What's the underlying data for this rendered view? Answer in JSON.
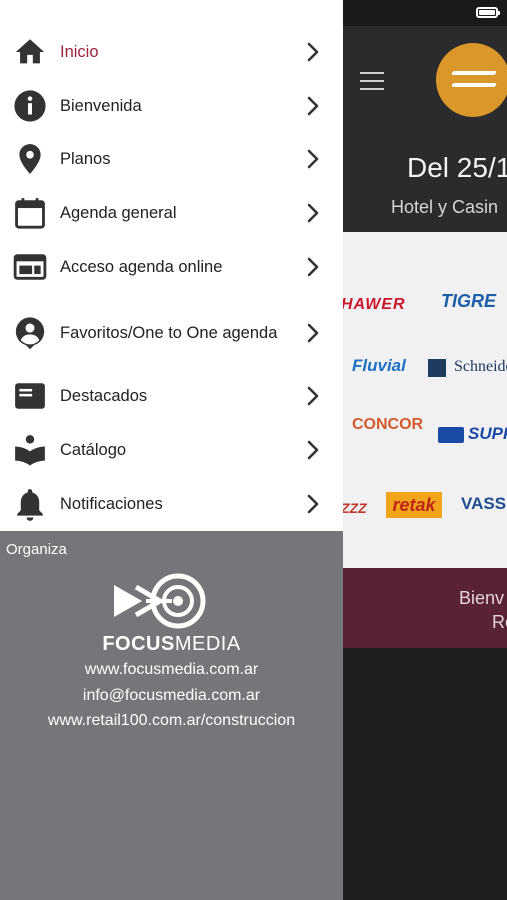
{
  "status_bar": {
    "battery_icon": "battery-full-icon"
  },
  "app": {
    "menu_icon": "hamburger-menu-icon",
    "brand_color": "#d99829",
    "date_title": "Del 25/1",
    "venue": "Hotel y Casin",
    "sponsors": [
      "HAWER",
      "TIGRE",
      "Fluvial",
      "Schneide",
      "CONCOR",
      "SUPP",
      "ZZZ",
      "retak",
      "VASSE"
    ],
    "welcome_line1": "Bienv",
    "welcome_line2": "Re"
  },
  "drawer": {
    "accent_color": "#9b2440",
    "items": [
      {
        "label": "Inicio",
        "icon": "home-icon",
        "active": true
      },
      {
        "label": "Bienvenida",
        "icon": "info-icon"
      },
      {
        "label": "Planos",
        "icon": "map-pin-icon"
      },
      {
        "label": "Agenda general",
        "icon": "calendar-icon"
      },
      {
        "label": "Acceso agenda online",
        "icon": "web-window-icon"
      },
      {
        "label": "Favoritos/One to One agenda",
        "icon": "account-pin-icon"
      },
      {
        "label": "Destacados",
        "icon": "featured-card-icon"
      },
      {
        "label": "Catálogo",
        "icon": "book-reader-icon"
      },
      {
        "label": "Notificaciones",
        "icon": "bell-icon"
      }
    ],
    "organizer": {
      "title": "Organiza",
      "logo_bold": "FOCUS",
      "logo_light": "MEDIA",
      "website": "www.focusmedia.com.ar",
      "email": "info@focusmedia.com.ar",
      "site2": "www.retail100.com.ar/construccion"
    }
  }
}
